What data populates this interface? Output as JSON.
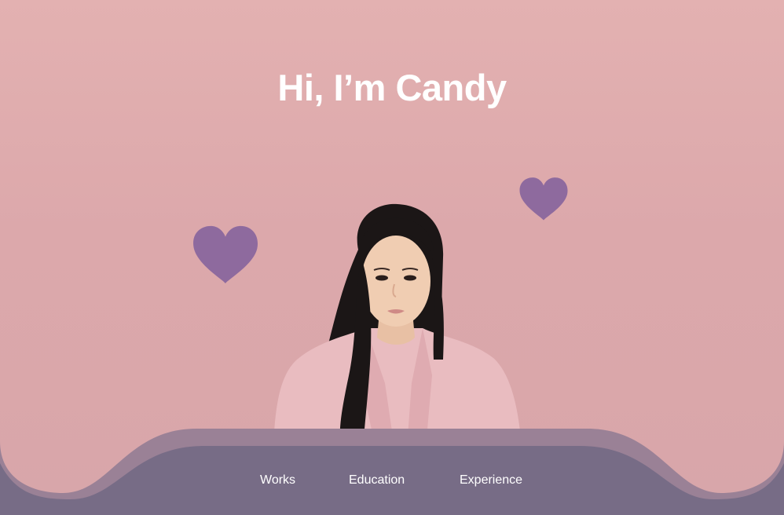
{
  "hero": {
    "title": "Hi, I’m Candy"
  },
  "decorations": {
    "heart_icon": "heart-icon",
    "heart_color": "#8e6a9e"
  },
  "portrait": {
    "alt": "Portrait photo of Candy",
    "shirt_color": "#e9bcc0",
    "hair_color": "#1b1616"
  },
  "nav": {
    "items": [
      {
        "label": "Works"
      },
      {
        "label": "Education"
      },
      {
        "label": "Experience"
      }
    ]
  },
  "colors": {
    "background": "#dca8ab",
    "footer": "#776c86",
    "footer_wave": "#9a8196",
    "text": "#ffffff"
  }
}
